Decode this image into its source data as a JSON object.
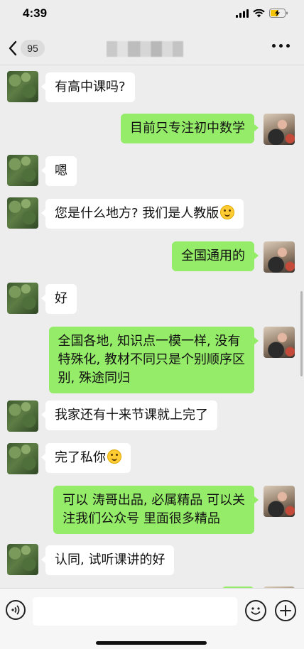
{
  "status_bar": {
    "time": "4:39"
  },
  "nav": {
    "unread_count": "95"
  },
  "messages": [
    {
      "side": "other",
      "text": "有高中课吗?"
    },
    {
      "side": "self",
      "text": "目前只专注初中数学"
    },
    {
      "side": "other",
      "text": "嗯"
    },
    {
      "side": "other",
      "text": "您是什么地方? 我们是人教版",
      "emoji": "smile-emoji"
    },
    {
      "side": "self",
      "text": "全国通用的"
    },
    {
      "side": "other",
      "text": "好"
    },
    {
      "side": "self",
      "lines": [
        "全国各地, 知识点一模一样, 没有",
        "特殊化, 教材不同只是个别顺序区",
        "别, 殊途同归"
      ]
    },
    {
      "side": "other",
      "text": "我家还有十来节课就上完了"
    },
    {
      "side": "other",
      "text": "完了私你",
      "emoji": "smile-emoji"
    },
    {
      "side": "self",
      "lines": [
        "可以  涛哥出品, 必属精品  可以关",
        "注我们公众号 里面很多精品"
      ]
    },
    {
      "side": "other",
      "text": "认同, 试听课讲的好"
    }
  ],
  "input_bar": {
    "placeholder": ""
  },
  "icons": {
    "back": "chevron-left-icon",
    "more": "more-dots-icon",
    "voice": "voice-icon",
    "emoji": "emoji-icon",
    "plus": "plus-icon"
  },
  "colors": {
    "self_bubble": "#95ec69",
    "other_bubble": "#ffffff",
    "background": "#ededed"
  }
}
